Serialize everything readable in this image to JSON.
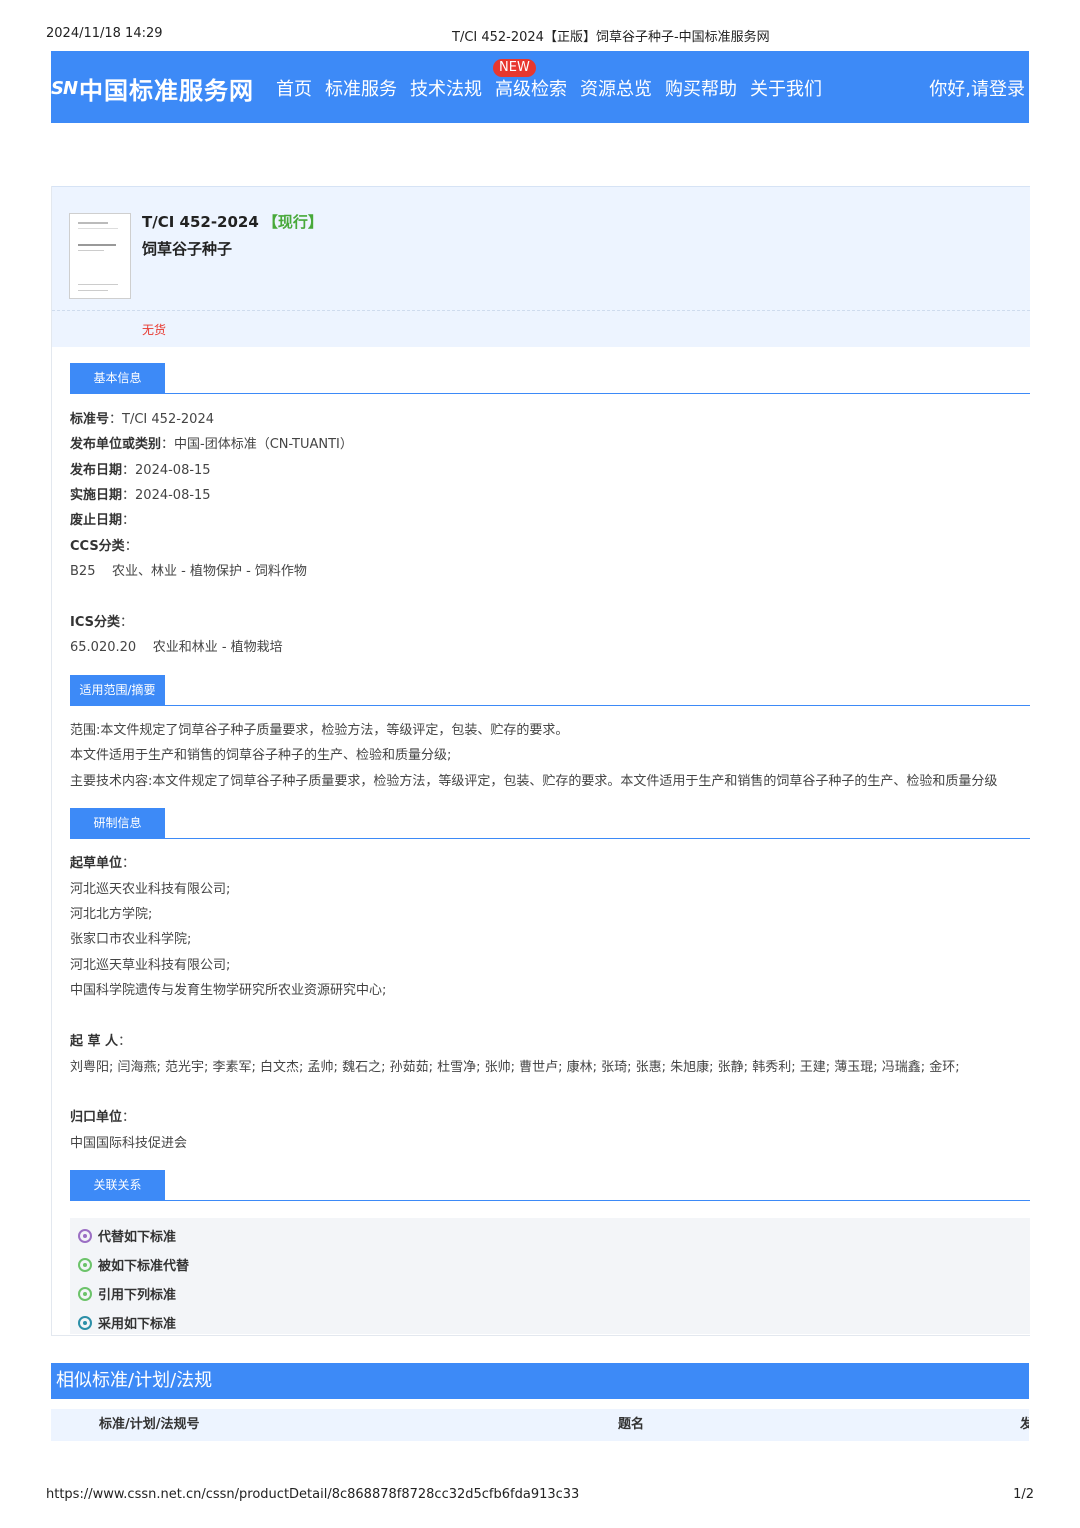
{
  "print_header": {
    "datetime": "2024/11/18 14:29",
    "page_title": "T/CI 452-2024【正版】饲草谷子种子-中国标准服务网"
  },
  "nav": {
    "logo_mark": "SN",
    "logo_text": "中国标准服务网",
    "items": [
      "首页",
      "标准服务",
      "技术法规",
      "高级检索",
      "资源总览",
      "购买帮助",
      "关于我们"
    ],
    "new_badge": "NEW",
    "login": "你好,请登录"
  },
  "summary": {
    "code": "T/CI 452-2024",
    "status": "【现行】",
    "name": "饲草谷子种子",
    "stock": "无货"
  },
  "sections": {
    "basic": "基本信息",
    "scope": "适用范围/摘要",
    "dev": "研制信息",
    "relation": "关联关系"
  },
  "basic_info": {
    "std_no_label": "标准号",
    "std_no": "T/CI 452-2024",
    "publisher_label": "发布单位或类别",
    "publisher": "中国-团体标准（CN-TUANTI）",
    "pub_date_label": "发布日期",
    "pub_date": "2024-08-15",
    "impl_date_label": "实施日期",
    "impl_date": "2024-08-15",
    "abolish_label": "废止日期",
    "abolish_date": "",
    "ccs_label": "CCS分类",
    "ccs_value": "B25    农业、林业 - 植物保护 - 饲料作物",
    "ics_label": "ICS分类",
    "ics_value": "65.020.20    农业和林业 - 植物栽培"
  },
  "scope": {
    "line1": "范围:本文件规定了饲草谷子种子质量要求，检验方法，等级评定，包装、贮存的要求。",
    "line2": "本文件适用于生产和销售的饲草谷子种子的生产、检验和质量分级;",
    "line3": "主要技术内容:本文件规定了饲草谷子种子质量要求，检验方法，等级评定，包装、贮存的要求。本文件适用于生产和销售的饲草谷子种子的生产、检验和质量分级"
  },
  "dev_info": {
    "drafter_units_label": "起草单位",
    "drafter_units": [
      "河北巡天农业科技有限公司;",
      "河北北方学院;",
      "张家口市农业科学院;",
      "河北巡天草业科技有限公司;",
      "中国科学院遗传与发育生物学研究所农业资源研究中心;"
    ],
    "drafters_label": "起 草 人",
    "drafters": "刘粤阳; 闫海燕; 范光宇; 李素军; 白文杰; 孟帅; 魏石之; 孙茹茹; 杜雪净; 张帅; 曹世卢; 康林; 张琦; 张惠; 朱旭康; 张静; 韩秀利; 王建; 薄玉琨; 冯瑞鑫; 金环;",
    "owner_label": "归口单位",
    "owner": "中国国际科技促进会"
  },
  "relations": [
    {
      "label": "代替如下标准",
      "color": "#9b6fc4"
    },
    {
      "label": "被如下标准代替",
      "color": "#6cc36a"
    },
    {
      "label": "引用下列标准",
      "color": "#6cc36a"
    },
    {
      "label": "采用如下标准",
      "color": "#2c8fa8"
    }
  ],
  "similar": {
    "title": "相似标准/计划/法规",
    "col_code": "标准/计划/法规号",
    "col_title": "题名",
    "col_extra": "发"
  },
  "print_footer": {
    "url": "https://www.cssn.net.cn/cssn/productDetail/8c868878f8728cc32d5cfb6fda913c33",
    "page": "1/2"
  }
}
